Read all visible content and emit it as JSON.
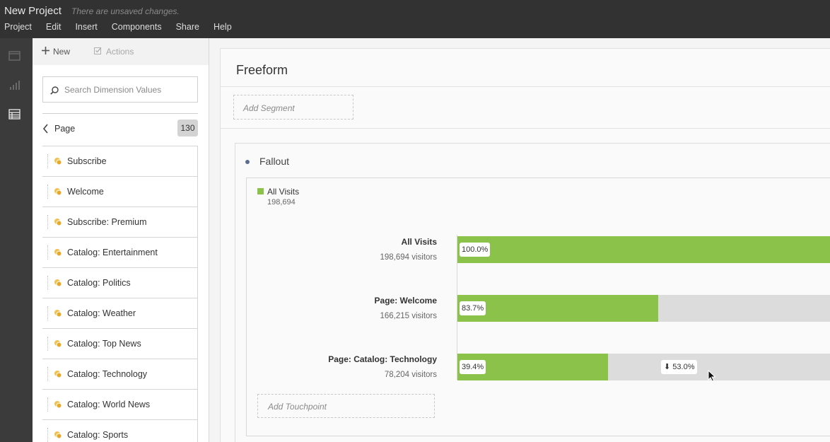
{
  "app": {
    "title": "New Project",
    "status": "There are unsaved changes."
  },
  "menu": [
    {
      "label": "Project"
    },
    {
      "label": "Edit"
    },
    {
      "label": "Insert"
    },
    {
      "label": "Components"
    },
    {
      "label": "Share"
    },
    {
      "label": "Help"
    }
  ],
  "rail": {
    "icons": [
      "panels-icon",
      "visualizations-icon",
      "components-icon"
    ]
  },
  "panel": {
    "new_label": "New",
    "actions_label": "Actions",
    "search_placeholder": "Search Dimension Values",
    "dimension": "Page",
    "count": "130",
    "items": [
      {
        "label": "Subscribe"
      },
      {
        "label": "Welcome"
      },
      {
        "label": "Subscribe: Premium"
      },
      {
        "label": "Catalog: Entertainment"
      },
      {
        "label": "Catalog: Politics"
      },
      {
        "label": "Catalog: Weather"
      },
      {
        "label": "Catalog: Top News"
      },
      {
        "label": "Catalog: Technology"
      },
      {
        "label": "Catalog: World News"
      },
      {
        "label": "Catalog: Sports"
      }
    ]
  },
  "main": {
    "freeform_title": "Freeform",
    "add_segment": "Add Segment",
    "viz_title": "Fallout",
    "add_touchpoint": "Add Touchpoint"
  },
  "colors": {
    "bar": "#8bc34a",
    "bar_bg": "#dcdcdc",
    "topbar": "#323232"
  },
  "chart_data": {
    "type": "bar",
    "legend": [
      {
        "name": "All Visits",
        "total": "198,694"
      }
    ],
    "steps": [
      {
        "name": "All Visits",
        "visitors": "198,694 visitors",
        "value": 100.0,
        "label": "100.0%",
        "drop": null
      },
      {
        "name": "Page: Welcome",
        "visitors": "166,215 visitors",
        "value": 83.7,
        "label": "83.7%",
        "drop": null
      },
      {
        "name": "Page: Catalog: Technology",
        "visitors": "78,204 visitors",
        "value": 39.4,
        "label": "39.4%",
        "drop": "53.0%"
      }
    ]
  }
}
